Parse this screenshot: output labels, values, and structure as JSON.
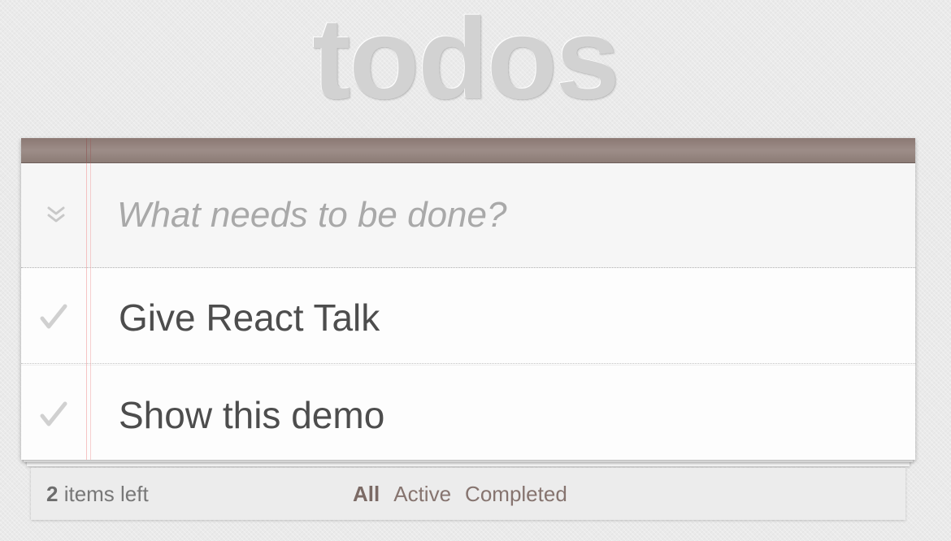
{
  "app": {
    "title": "todos"
  },
  "new_todo": {
    "placeholder": "What needs to be done?",
    "value": ""
  },
  "todos": [
    {
      "label": "Give React Talk",
      "completed": false
    },
    {
      "label": "Show this demo",
      "completed": false
    }
  ],
  "footer": {
    "count_number": "2",
    "count_suffix": " items left",
    "filters": [
      {
        "label": "All",
        "selected": true
      },
      {
        "label": "Active",
        "selected": false
      },
      {
        "label": "Completed",
        "selected": false
      }
    ]
  },
  "colors": {
    "header_bar": "#8b7873",
    "title": "#d2d2d2",
    "margin_line": "#f09696",
    "filter_link": "#86746f"
  },
  "icons": {
    "toggle_all": "double-chevron-down-icon",
    "item_check": "checkmark-icon"
  }
}
